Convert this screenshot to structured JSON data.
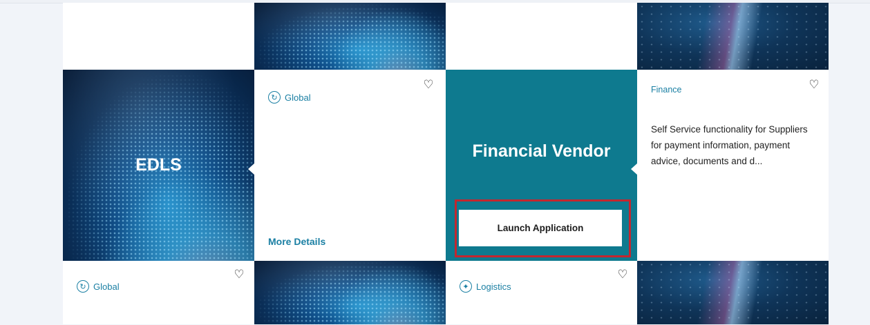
{
  "tiles": {
    "edls": {
      "title": "EDLS"
    },
    "global_top": {
      "tag": "Global",
      "more_details": "More Details"
    },
    "financial_vendor": {
      "title": "Financial Vendor",
      "launch": "Launch Application"
    },
    "finance": {
      "tag": "Finance",
      "description": "Self Service functionality for Suppliers for payment information, payment advice, documents and d..."
    },
    "global_bottom": {
      "tag": "Global"
    },
    "logistics": {
      "tag": "Logistics"
    }
  },
  "icons": {
    "heart": "heart-outline-icon",
    "global": "global-icon",
    "logistics": "logistics-icon"
  },
  "colors": {
    "accent": "#1a7fa3",
    "teal_tile": "#0e7a8f",
    "highlight": "#c4262e"
  }
}
